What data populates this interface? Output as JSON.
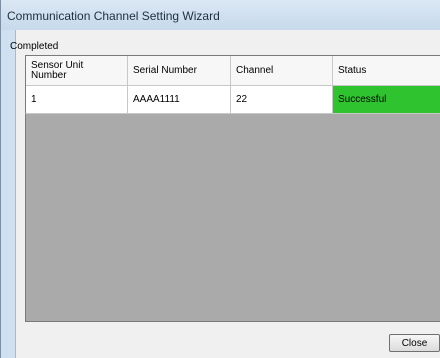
{
  "window": {
    "title": "Communication Channel Setting Wizard"
  },
  "group": {
    "label": "Completed"
  },
  "table": {
    "columns": [
      "Sensor Unit\nNumber",
      "Serial Number",
      "Channel",
      "Status"
    ],
    "rows": [
      [
        "1",
        "AAAA1111",
        "22",
        "Successful"
      ]
    ]
  },
  "buttons": {
    "close_label": "Close"
  },
  "colors": {
    "success": "#2fc42f",
    "grid_background": "#aaaaaa"
  }
}
